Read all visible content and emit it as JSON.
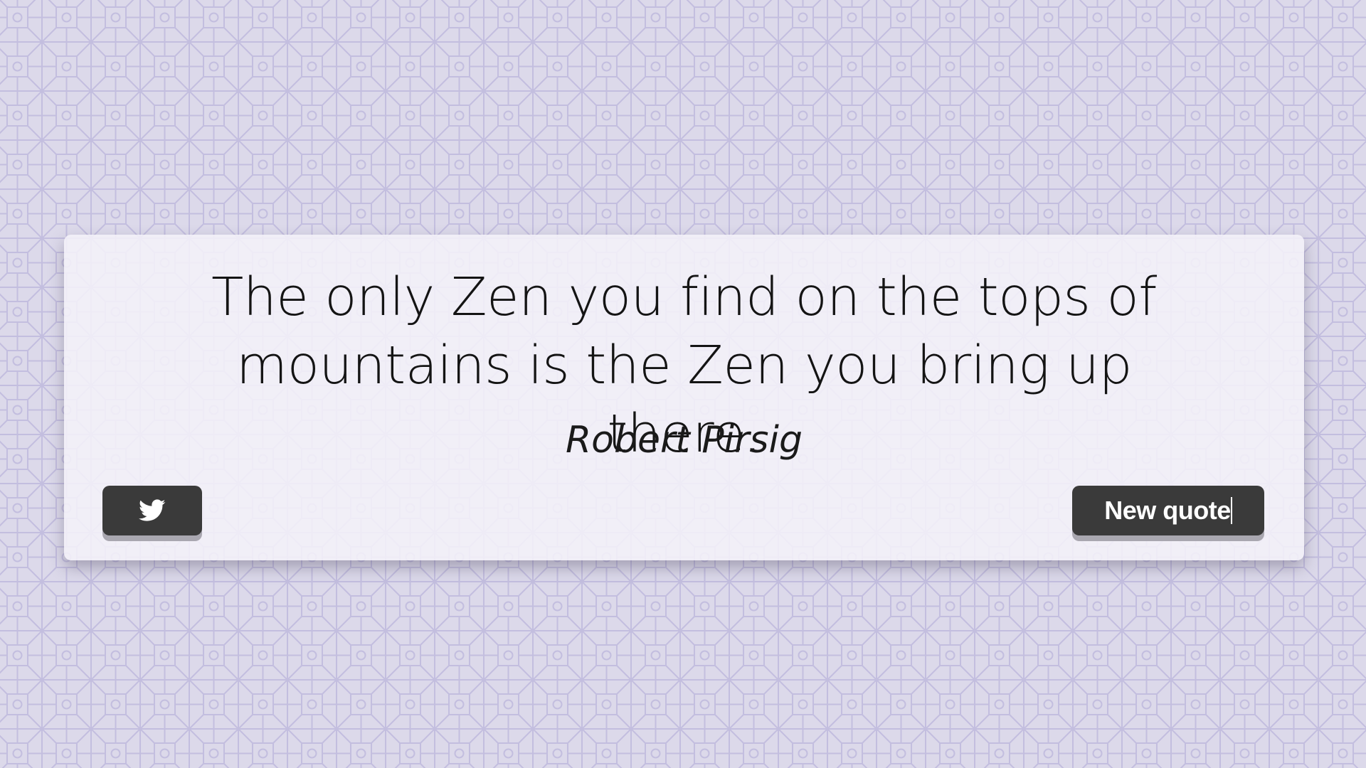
{
  "quote": {
    "text": "The only Zen you find on the tops of mountains is the Zen you bring up there.",
    "author": "Robert Pirsig"
  },
  "actions": {
    "tweet_icon": "twitter-bird-icon",
    "new_quote_label": "New quote"
  },
  "colors": {
    "background": "#dcd9ea",
    "pattern": "#c3bedf",
    "card": "#f4f2f9",
    "button": "#3a3a3a",
    "button_text": "#ffffff",
    "button_shadow": "#a9a7b0"
  }
}
